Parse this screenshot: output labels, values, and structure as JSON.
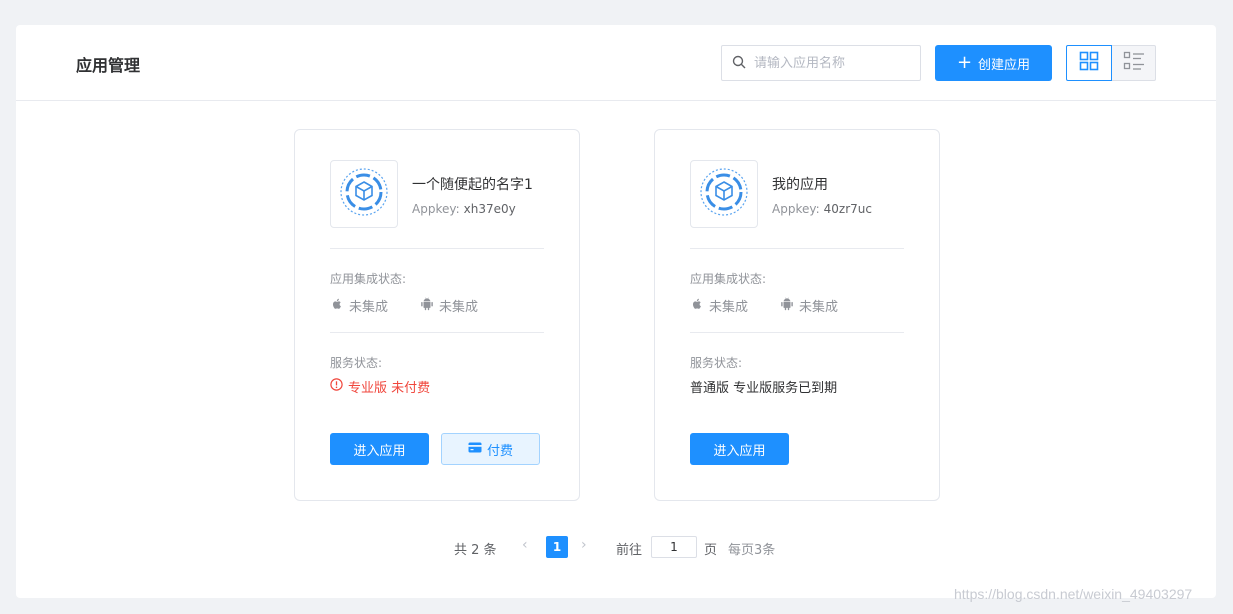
{
  "header": {
    "title": "应用管理",
    "search_placeholder": "请输入应用名称",
    "search_value": "",
    "create_label": "创建应用",
    "accent_color": "#1e90ff"
  },
  "view_toggle": {
    "grid_icon": "grid-icon",
    "list_icon": "list-icon",
    "active": "grid"
  },
  "apps": [
    {
      "name": "一个随便起的名字1",
      "appkey_label": "Appkey:",
      "appkey": "xh37e0y",
      "integration_label": "应用集成状态:",
      "ios_status": "未集成",
      "android_status": "未集成",
      "service_label": "服务状态:",
      "service_status": "专业版 未付费",
      "enter_label": "进入应用",
      "pay_label": "付费"
    },
    {
      "name": "我的应用",
      "appkey_label": "Appkey:",
      "appkey": "40zr7uc",
      "integration_label": "应用集成状态:",
      "ios_status": "未集成",
      "android_status": "未集成",
      "service_label": "服务状态:",
      "service_status": "普通版 专业版服务已到期",
      "enter_label": "进入应用"
    }
  ],
  "pagination": {
    "total": "共 2 条",
    "current_page": "1",
    "goto_label": "前往",
    "goto_value": "1",
    "goto_suffix": "页",
    "per_page": "每页3条"
  },
  "watermark": "https://blog.csdn.net/weixin_49403297"
}
